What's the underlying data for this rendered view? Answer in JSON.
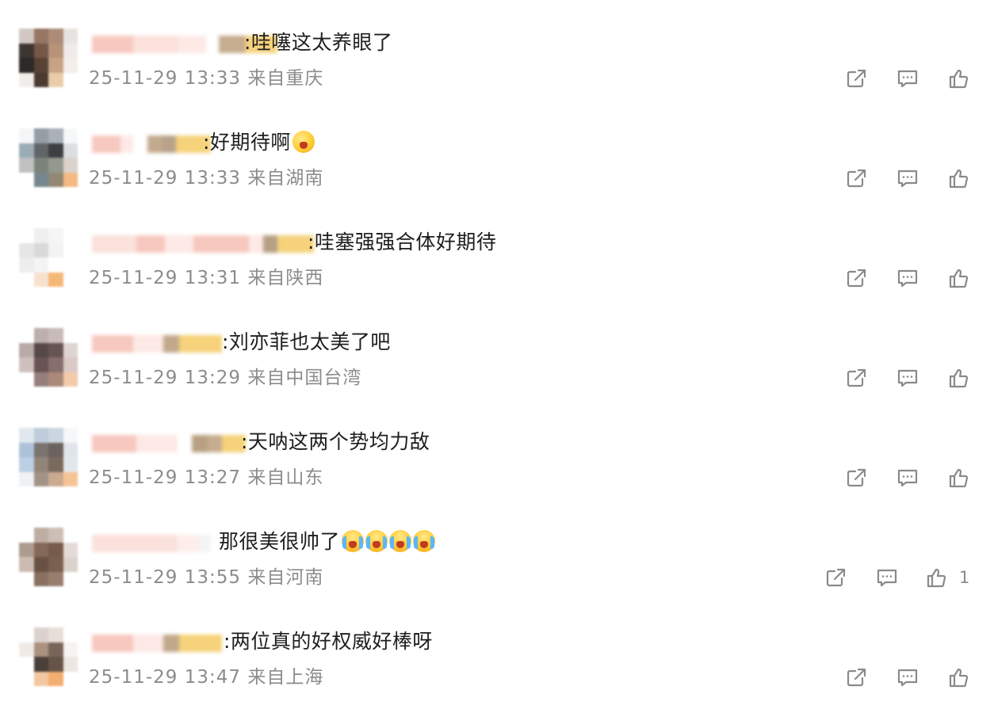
{
  "comments": [
    {
      "text": ":哇噻这太养眼了",
      "emoji": [],
      "time": "25-11-29 13:33",
      "location": "来自重庆",
      "likes": ""
    },
    {
      "text": ":好期待啊",
      "emoji": [
        "surprised-face"
      ],
      "time": "25-11-29 13:33",
      "location": "来自湖南",
      "likes": ""
    },
    {
      "text": ":哇塞强强合体好期待",
      "emoji": [],
      "time": "25-11-29 13:31",
      "location": "来自陕西",
      "likes": ""
    },
    {
      "text": ":刘亦菲也太美了吧",
      "emoji": [],
      "time": "25-11-29 13:29",
      "location": "来自中国台湾",
      "likes": ""
    },
    {
      "text": ":天呐这两个势均力敌",
      "emoji": [],
      "time": "25-11-29 13:27",
      "location": "来自山东",
      "likes": ""
    },
    {
      "text": "那很美很帅了",
      "emoji": [
        "crying-face",
        "crying-face",
        "crying-face",
        "crying-face"
      ],
      "time": "25-11-29 13:55",
      "location": "来自河南",
      "likes": "1"
    },
    {
      "text": ":两位真的好权威好棒呀",
      "emoji": [],
      "time": "25-11-29 13:47",
      "location": "来自上海",
      "likes": ""
    }
  ],
  "icons": {
    "repost": "share-external-icon",
    "comment": "comment-bubble-icon",
    "like": "thumbs-up-icon"
  },
  "colors": {
    "text": "#1e1e1e",
    "meta": "#8c8c8c",
    "icon": "#8a8a8a"
  }
}
